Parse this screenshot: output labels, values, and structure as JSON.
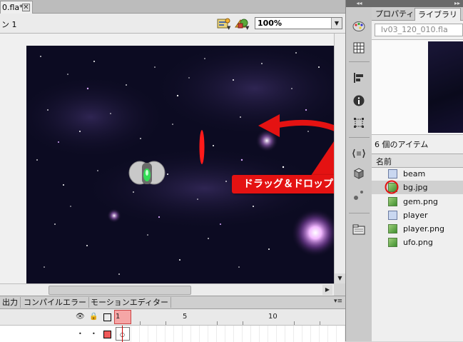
{
  "document_tab": {
    "label": "0.fla*",
    "close_glyph": "✕"
  },
  "edit_bar": {
    "scene_label": "ン 1",
    "edit_symbol_icon": "edit-symbol-icon",
    "edit_scene_icon": "edit-scene-icon",
    "zoom": "100%",
    "dropdown_glyph": "▼"
  },
  "timeline": {
    "tabs": [
      "出力",
      "コンパイルエラー",
      "モーションエディター"
    ],
    "panel_menu_glyph": "▾≡",
    "header": {
      "eye_icon": "👁",
      "lock_icon": "🔒"
    },
    "frame_numbers": [
      "1",
      "5",
      "10"
    ],
    "row_markers": [
      "•",
      "•"
    ],
    "keyframe_glyph": "○",
    "current_frame_color": "#f5a6a6"
  },
  "tools_panel": {
    "collapse_glyph": "◂◂",
    "icons": [
      "color-palette-icon",
      "swatches-icon",
      "align-icon",
      "info-icon",
      "transform-icon",
      "components-icon",
      "3d-icon",
      "library-folder-icon"
    ]
  },
  "library_panel": {
    "collapse_glyph": "▸▸",
    "tabs": {
      "properties": "プロパティ",
      "library": "ライブラリ"
    },
    "document": "lv03_120_010.fla",
    "item_count": "6 個のアイテム",
    "column_name": "名前",
    "items": [
      {
        "name": "beam",
        "type": "movie-clip"
      },
      {
        "name": "bg.jpg",
        "type": "bitmap",
        "selected": true
      },
      {
        "name": "gem.png",
        "type": "bitmap"
      },
      {
        "name": "player",
        "type": "movie-clip"
      },
      {
        "name": "player.png",
        "type": "bitmap"
      },
      {
        "name": "ufo.png",
        "type": "bitmap"
      }
    ]
  },
  "annotation": {
    "label": "ドラッグ＆ドロップ",
    "color": "#e41212"
  },
  "scrollbar_glyphs": {
    "down": "▼",
    "right": "▶"
  }
}
